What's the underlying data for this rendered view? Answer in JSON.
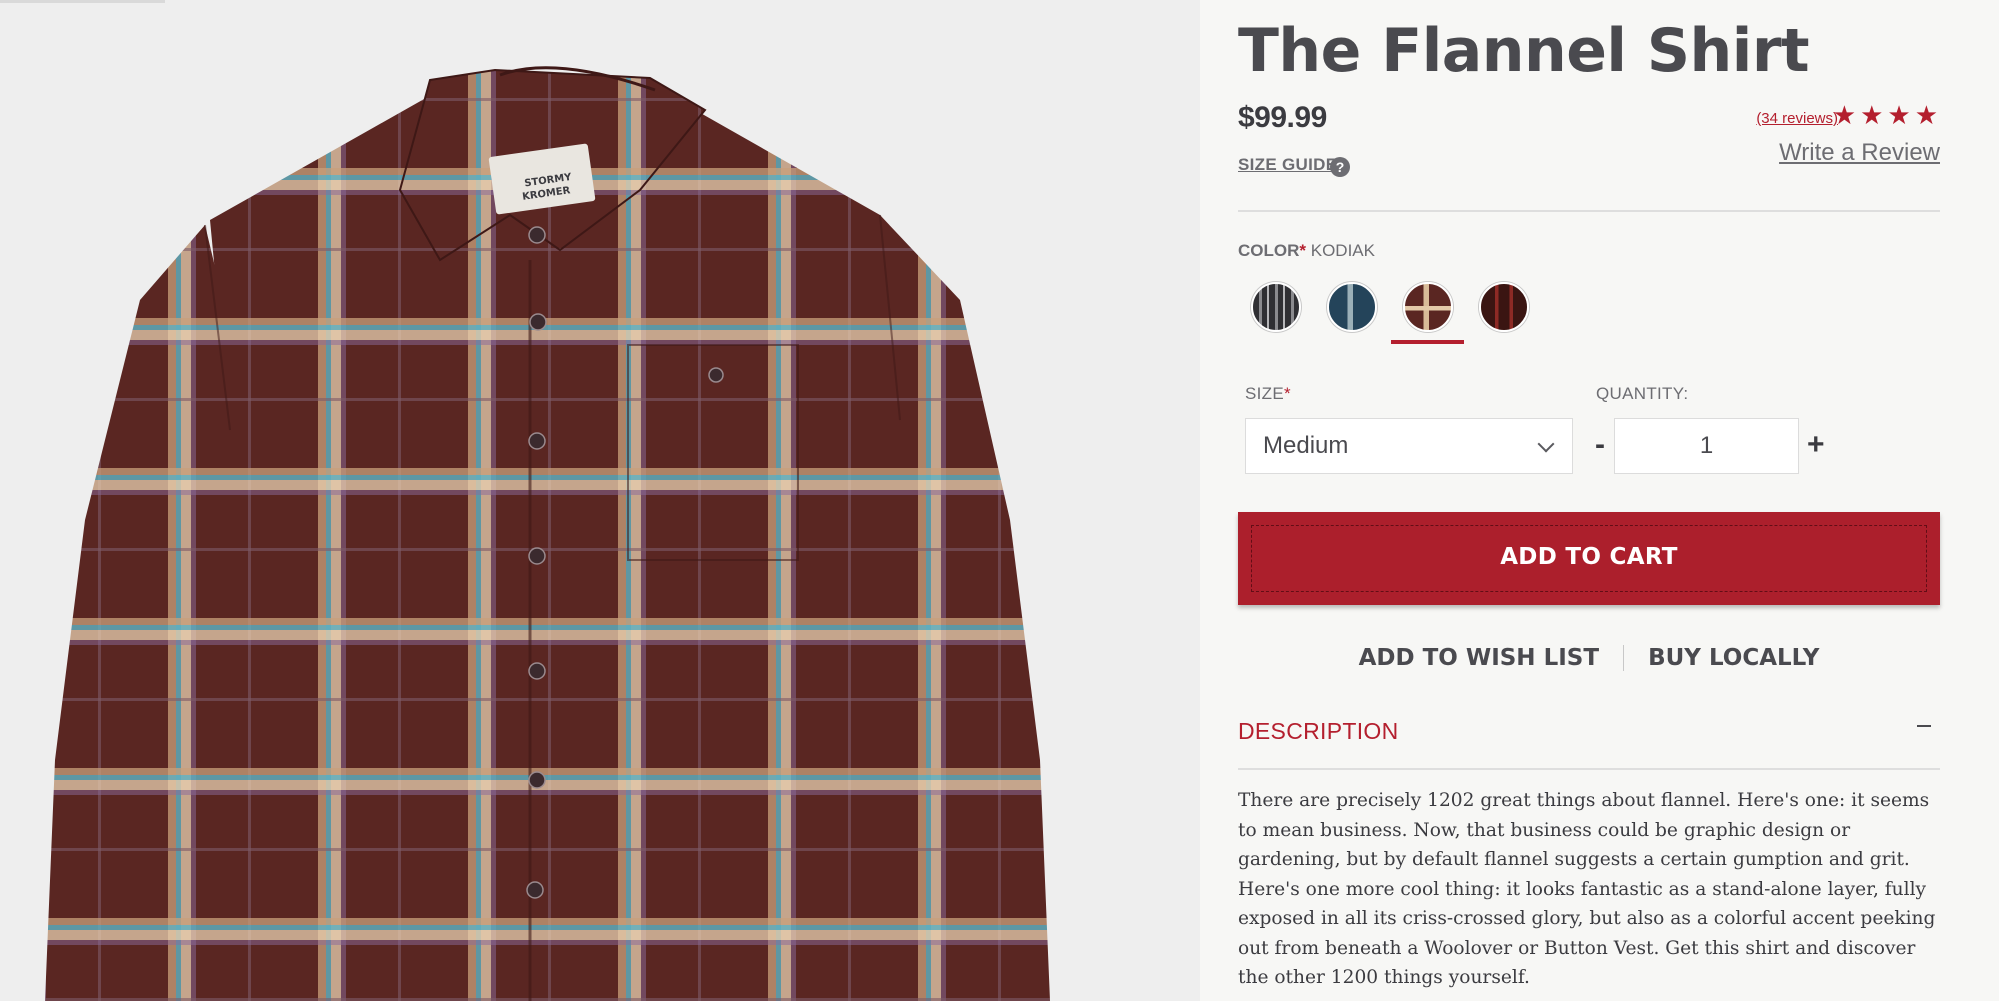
{
  "product": {
    "title": "The Flannel Shirt",
    "price": "$99.99",
    "size_guide_label": "SIZE GUIDE",
    "help_icon": "question-circle-icon",
    "reviews_link": "(34 reviews)",
    "rating_stars": 4,
    "write_review_label": "Write a Review"
  },
  "color": {
    "label": "COLOR",
    "required_marker": "*",
    "selected_name": "KODIAK",
    "swatches": [
      {
        "name": "charcoal-plaid",
        "colors": [
          "#2f2f33",
          "#7c7c80",
          "#a9a9ad"
        ]
      },
      {
        "name": "blue-plaid",
        "colors": [
          "#2a4a5c",
          "#7e9aa8",
          "#c7b38a"
        ]
      },
      {
        "name": "kodiak",
        "colors": [
          "#5a2622",
          "#a98a74",
          "#e6d1b8"
        ]
      },
      {
        "name": "red-plaid",
        "colors": [
          "#3a1512",
          "#8d2a25",
          "#1e0a08"
        ]
      }
    ],
    "selected_index": 2
  },
  "size": {
    "label": "SIZE",
    "required_marker": "*",
    "selected": "Medium"
  },
  "quantity": {
    "label": "QUANTITY:",
    "value": "1",
    "minus": "-",
    "plus": "+"
  },
  "actions": {
    "add_to_cart": "ADD TO CART",
    "add_to_wish_list": "ADD TO WISH LIST",
    "buy_locally": "BUY LOCALLY"
  },
  "description": {
    "heading": "DESCRIPTION",
    "body": "There are precisely 1202 great things about flannel. Here's one: it seems to mean business. Now, that business could be graphic design or gardening, but by default flannel suggests a certain gumption and grit. Here's one more cool thing: it looks fantastic as a stand-alone layer, fully exposed in all its criss-crossed glory, but also as a colorful accent peeking out from beneath a Woolover or Button Vest. Get this shirt and discover the other 1200 things yourself."
  },
  "colors": {
    "accent": "#b41f2e",
    "button": "#ac1f2c",
    "text": "#4a4a4f",
    "shirt_base": "#5a2622"
  },
  "image": {
    "label_text": "STORMY KROMER"
  }
}
